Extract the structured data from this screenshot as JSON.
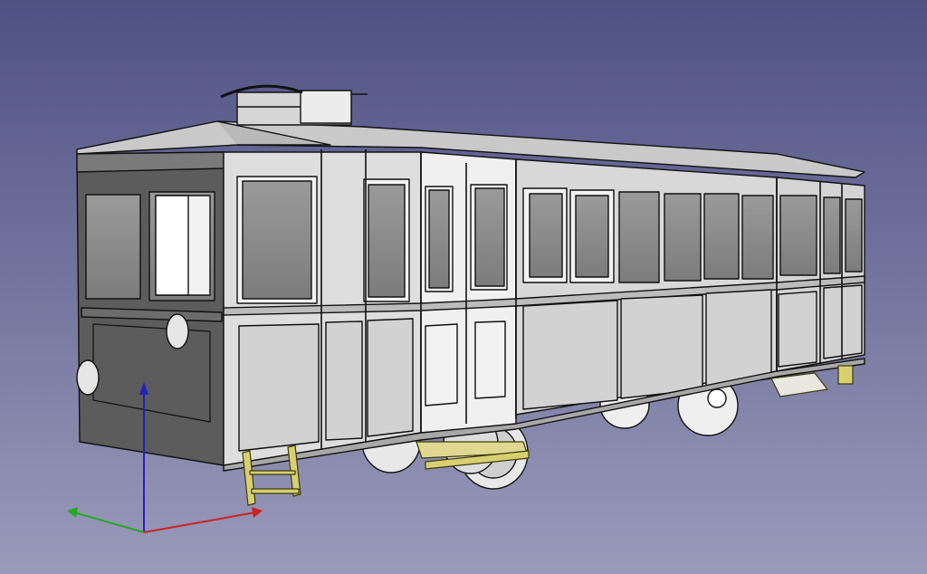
{
  "viewport": {
    "background_top": "#4f5184",
    "background_bottom": "#9a9aba"
  },
  "model": {
    "body_color": "#dadada",
    "body_dark": "#5a5a5a",
    "window_color": "#8c8c8c",
    "frame_color": "#f2f2f2",
    "edge_color": "#111111",
    "step_color": "#d8d070"
  },
  "axis": {
    "x_color": "#cc2222",
    "y_color": "#22aa22",
    "z_color": "#2222bb"
  }
}
